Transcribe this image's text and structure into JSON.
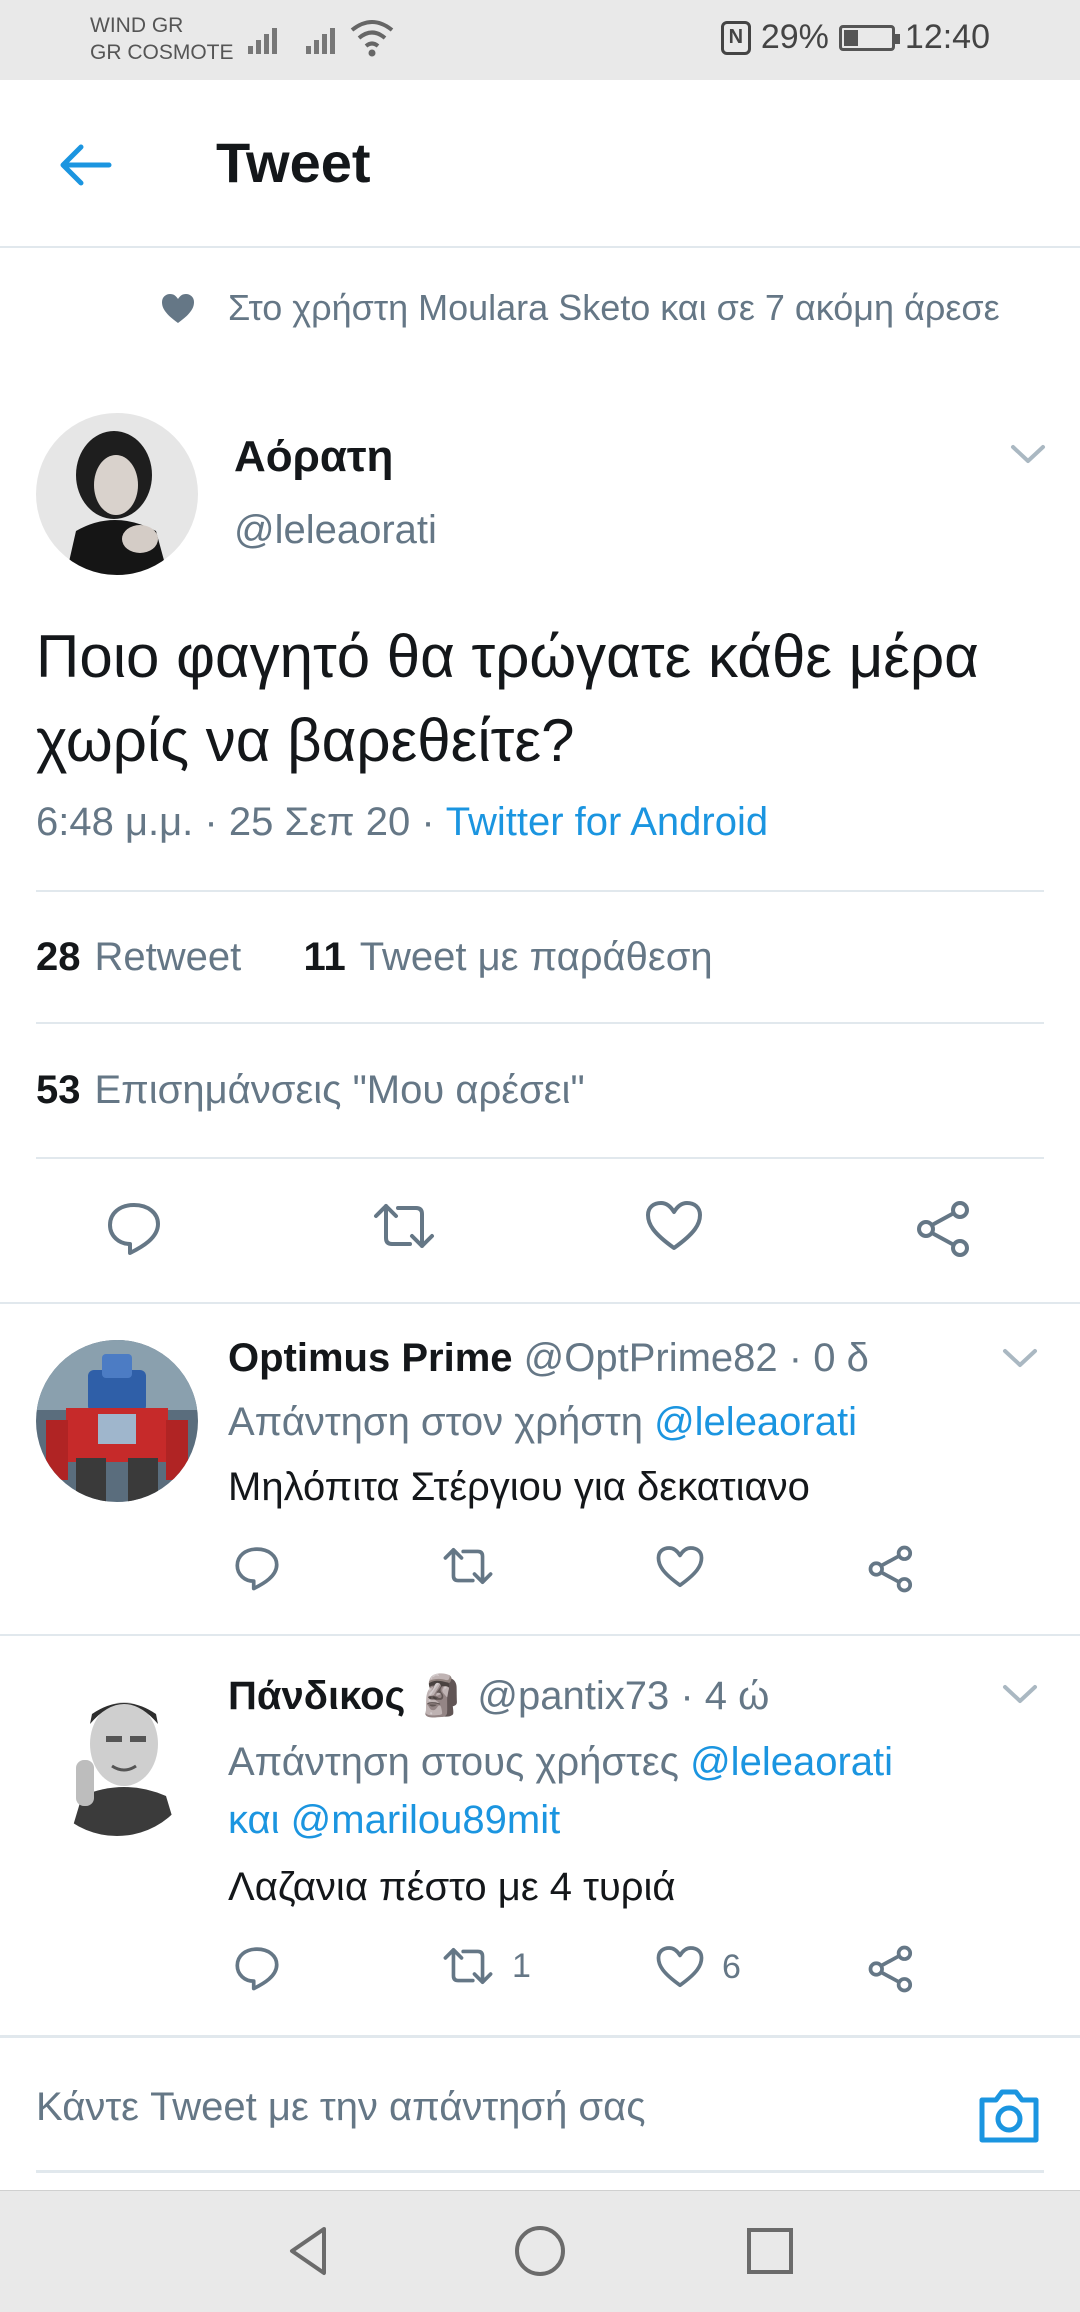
{
  "status_bar": {
    "carrier1": "WIND GR",
    "carrier2": "GR COSMOTE",
    "nfc": "N",
    "battery": "29%",
    "battery_level": 0.29,
    "time": "12:40"
  },
  "header": {
    "title": "Tweet"
  },
  "liked_by": {
    "text": "Στο χρήστη Moulara Sketo και σε 7 ακόμη άρεσε"
  },
  "tweet": {
    "author_name": "Αόρατη",
    "author_handle": "@leleaorati",
    "text": "Ποιο φαγητό θα τρώγατε κάθε μέρα χωρίς να βαρεθείτε?",
    "meta_time": "6:48 μ.μ. · 25 Σεπ 20 · ",
    "meta_source": "Twitter for Android",
    "retweets_count": "28",
    "retweets_label": "Retweet",
    "quotes_count": "11",
    "quotes_label": "Tweet με παράθεση",
    "likes_count": "53",
    "likes_label": "Επισημάνσεις \"Μου αρέσει\""
  },
  "replies": [
    {
      "name": "Optimus Prime",
      "handle_time": "@OptPrime82 · 0 δ",
      "reply_prefix": "Απάντηση στον χρήστη ",
      "mention1": "@leleaorati",
      "reply_mid": "",
      "mention2": "",
      "text": "Μηλόπιτα Στέργιου για δεκατιανο",
      "retweet_count": "",
      "like_count": ""
    },
    {
      "name": "Πάνδικος",
      "emoji": "🗿",
      "handle_time": "@pantix73 · 4 ώ",
      "reply_prefix": "Απάντηση στους χρήστες ",
      "mention1": "@leleaorati",
      "reply_mid": "και ",
      "mention2": "@marilou89mit",
      "text": "Λαζανια πέστο με 4 τυριά",
      "retweet_count": "1",
      "like_count": "6"
    }
  ],
  "compose": {
    "placeholder": "Κάντε Tweet με την απάντησή σας"
  },
  "colors": {
    "accent": "#1b95e0",
    "secondary_text": "#657786",
    "divider": "#e1e8ed"
  }
}
